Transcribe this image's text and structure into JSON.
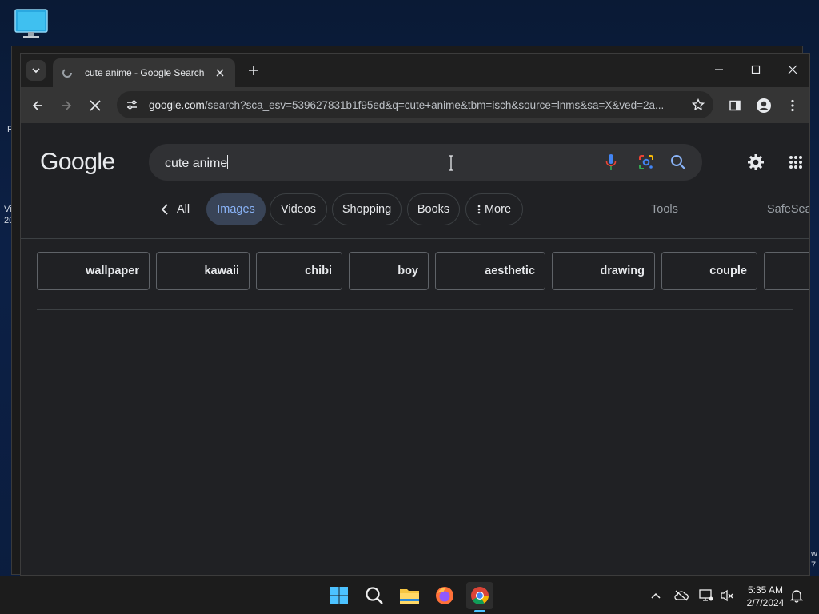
{
  "desktop": {
    "left_edge_texts": [
      "R",
      "Vi",
      "20"
    ],
    "right_edge_texts": [
      "w",
      "7"
    ]
  },
  "browser": {
    "tab": {
      "title": "cute anime - Google Search"
    },
    "address_bar": {
      "domain": "google.com",
      "path": "/search?sca_esv=539627831b1f95ed&q=cute+anime&tbm=isch&source=lnms&sa=X&ved=2a..."
    }
  },
  "google": {
    "logo": "Google",
    "search_query": "cute anime",
    "tabs": [
      {
        "label": "All",
        "active": false
      },
      {
        "label": "Images",
        "active": true
      },
      {
        "label": "Videos",
        "active": false
      },
      {
        "label": "Shopping",
        "active": false
      },
      {
        "label": "Books",
        "active": false
      },
      {
        "label": "More",
        "active": false
      }
    ],
    "tools_label": "Tools",
    "safesearch_label": "SafeSea",
    "refinements": [
      "wallpaper",
      "kawaii",
      "chibi",
      "boy",
      "aesthetic",
      "drawing",
      "couple",
      ""
    ]
  },
  "colors": {
    "accent": "#8ab4f8",
    "page_bg": "#202124",
    "toolbar_bg": "#353535"
  },
  "taskbar": {
    "apps": [
      "start-icon",
      "search-icon",
      "file-explorer-icon",
      "firefox-icon",
      "chrome-icon"
    ],
    "time": "5:35 AM",
    "date": "2/7/2024"
  }
}
